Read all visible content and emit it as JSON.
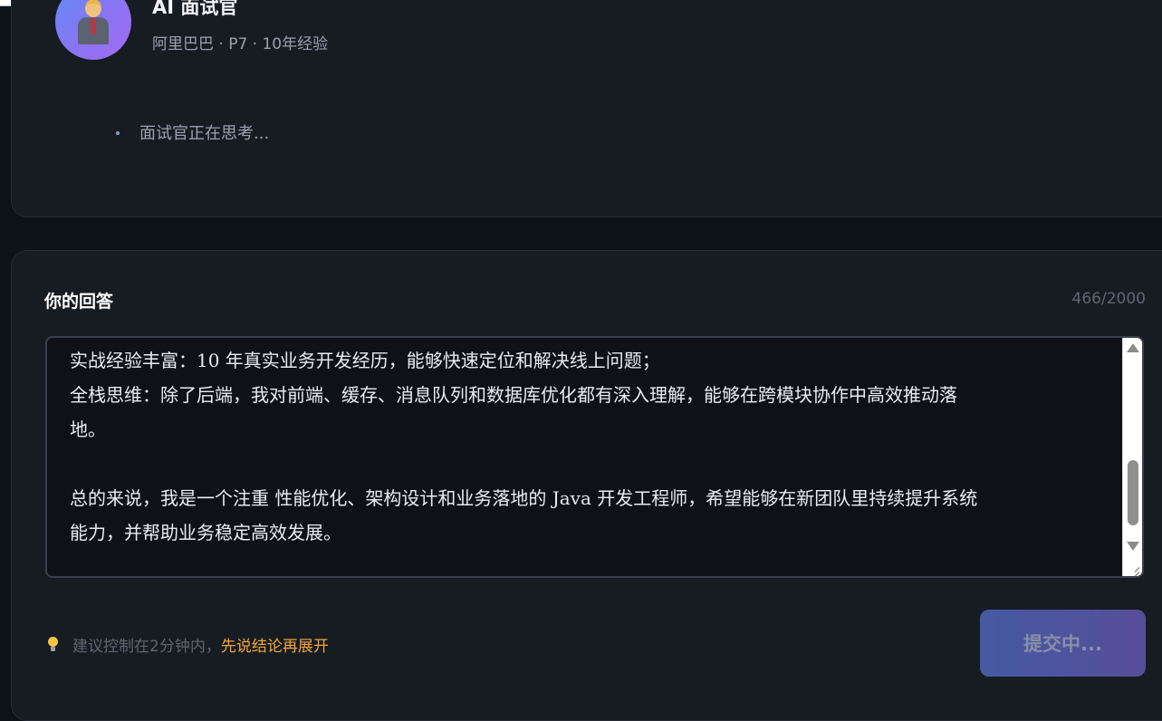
{
  "interviewer": {
    "title": "AI 面试官",
    "subtitle": "阿里巴巴 · P7 · 10年经验",
    "status": "面试官正在思考..."
  },
  "answer": {
    "title": "你的回答",
    "counter": "466/2000",
    "text": "实战经验丰富：10 年真实业务开发经历，能够快速定位和解决线上问题；\n全栈思维：除了后端，我对前端、缓存、消息队列和数据库优化都有深入理解，能够在跨模块协作中高效推动落\n地。\n\n总的来说，我是一个注重 性能优化、架构设计和业务落地的 Java 开发工程师，希望能够在新团队里持续提升系统\n能力，并帮助业务稳定高效发展。",
    "tip_text": "建议控制在2分钟内，",
    "tip_highlight": "先说结论再展开",
    "submit_label": "提交中..."
  },
  "icons": {
    "avatar": "businessman-avatar-icon",
    "tip": "lightbulb-icon"
  },
  "colors": {
    "background": "#0d1118",
    "card": "#171b22",
    "highlight": "#f0a63b",
    "avatar_gradient_start": "#5f8cf7",
    "avatar_gradient_end": "#a26cf0"
  }
}
